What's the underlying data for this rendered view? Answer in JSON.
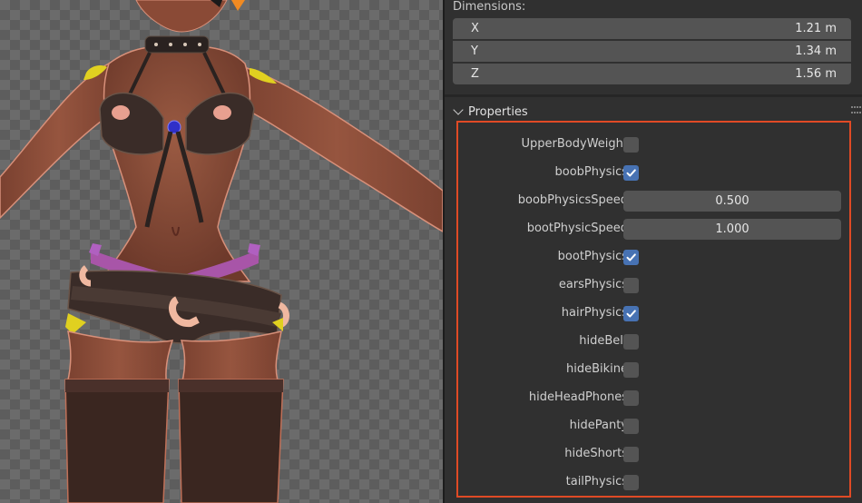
{
  "dimensions": {
    "label": "Dimensions:",
    "rows": [
      {
        "axis": "X",
        "value": "1.21 m"
      },
      {
        "axis": "Y",
        "value": "1.34 m"
      },
      {
        "axis": "Z",
        "value": "1.56 m"
      }
    ]
  },
  "properties": {
    "title": "Properties",
    "items": [
      {
        "label": "UpperBodyWeight",
        "type": "checkbox",
        "checked": false
      },
      {
        "label": "boobPhysics",
        "type": "checkbox",
        "checked": true
      },
      {
        "label": "boobPhysicsSpeed",
        "type": "number",
        "value": "0.500"
      },
      {
        "label": "bootPhysicSpeed",
        "type": "number",
        "value": "1.000"
      },
      {
        "label": "bootPhysics",
        "type": "checkbox",
        "checked": true
      },
      {
        "label": "earsPhysics",
        "type": "checkbox",
        "checked": false
      },
      {
        "label": "hairPhysics",
        "type": "checkbox",
        "checked": true
      },
      {
        "label": "hideBelt",
        "type": "checkbox",
        "checked": false
      },
      {
        "label": "hideBikine",
        "type": "checkbox",
        "checked": false
      },
      {
        "label": "hideHeadPhones",
        "type": "checkbox",
        "checked": false
      },
      {
        "label": "hidePanty",
        "type": "checkbox",
        "checked": false
      },
      {
        "label": "hideShorts",
        "type": "checkbox",
        "checked": false
      },
      {
        "label": "tailPhysics",
        "type": "checkbox",
        "checked": false
      }
    ]
  },
  "colors": {
    "checkbox_on": "#4772b3",
    "highlight_border": "#e04a25",
    "panel_bg": "#303030",
    "field_bg": "#545454"
  },
  "icons": {
    "section_toggle": "chevron-down-icon",
    "drag_handle": "drag-grip-icon",
    "check": "checkmark-icon"
  }
}
